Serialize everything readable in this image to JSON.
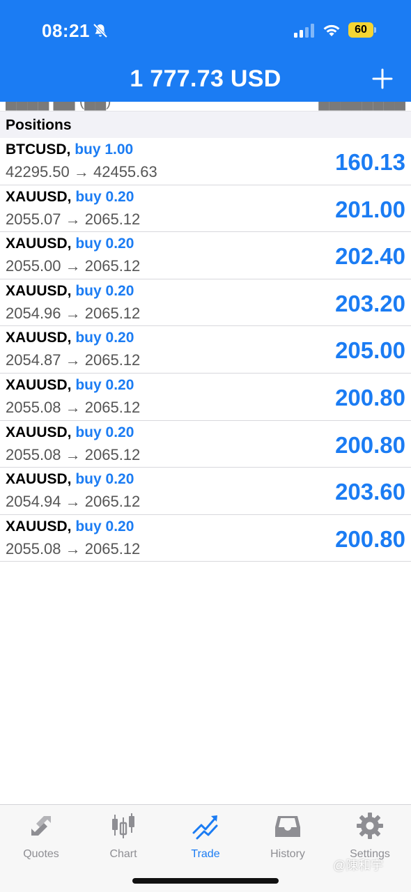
{
  "status_bar": {
    "time": "08:21",
    "battery": "60"
  },
  "header": {
    "balance": "1 777.73 USD"
  },
  "section": {
    "title": "Positions"
  },
  "positions": [
    {
      "symbol": "BTCUSD,",
      "side": "buy 1.00",
      "prices": "42295.50 → 42455.63",
      "profit": "160.13"
    },
    {
      "symbol": "XAUUSD,",
      "side": "buy 0.20",
      "prices": "2055.07 → 2065.12",
      "profit": "201.00"
    },
    {
      "symbol": "XAUUSD,",
      "side": "buy 0.20",
      "prices": "2055.00 → 2065.12",
      "profit": "202.40"
    },
    {
      "symbol": "XAUUSD,",
      "side": "buy 0.20",
      "prices": "2054.96 → 2065.12",
      "profit": "203.20"
    },
    {
      "symbol": "XAUUSD,",
      "side": "buy 0.20",
      "prices": "2054.87 → 2065.12",
      "profit": "205.00"
    },
    {
      "symbol": "XAUUSD,",
      "side": "buy 0.20",
      "prices": "2055.08 → 2065.12",
      "profit": "200.80"
    },
    {
      "symbol": "XAUUSD,",
      "side": "buy 0.20",
      "prices": "2055.08 → 2065.12",
      "profit": "200.80"
    },
    {
      "symbol": "XAUUSD,",
      "side": "buy 0.20",
      "prices": "2054.94 → 2065.12",
      "profit": "203.60"
    },
    {
      "symbol": "XAUUSD,",
      "side": "buy 0.20",
      "prices": "2055.08 → 2065.12",
      "profit": "200.80"
    }
  ],
  "tabs": [
    {
      "label": "Quotes",
      "icon": "quotes-arrows-icon",
      "active": false
    },
    {
      "label": "Chart",
      "icon": "candlestick-icon",
      "active": false
    },
    {
      "label": "Trade",
      "icon": "trend-chart-icon",
      "active": true
    },
    {
      "label": "History",
      "icon": "inbox-tray-icon",
      "active": false
    },
    {
      "label": "Settings",
      "icon": "gear-icon",
      "active": false
    }
  ],
  "watermark": "@陳和宇",
  "colors": {
    "accent": "#1b7cf3",
    "header_bg": "#1b7cf3",
    "battery": "#f5d533",
    "tab_inactive": "#8e8e93"
  }
}
